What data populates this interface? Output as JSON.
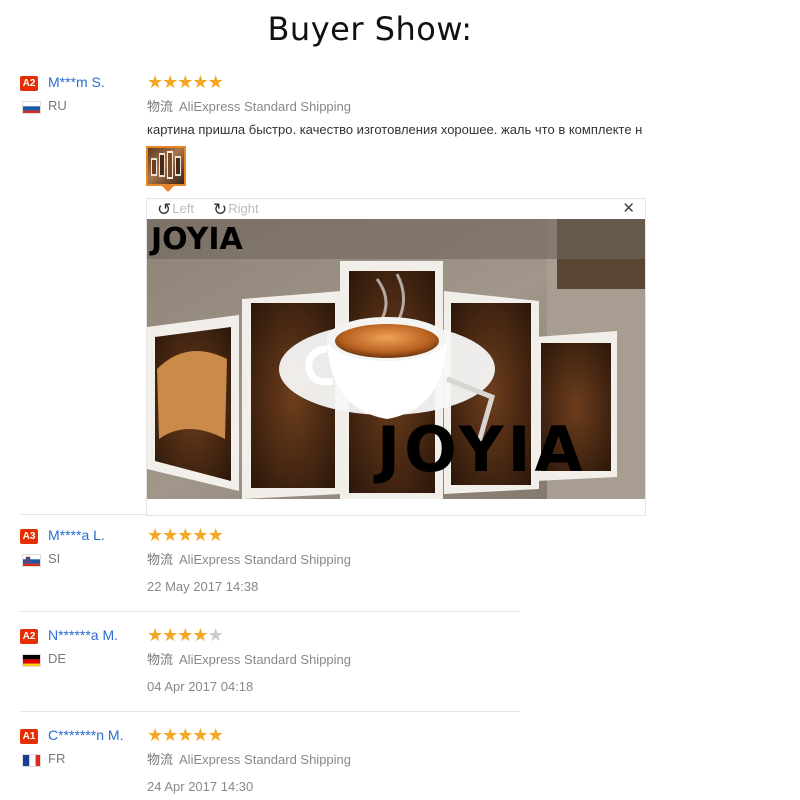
{
  "page": {
    "title": "Buyer Show:"
  },
  "reviews": [
    {
      "badge": "A2",
      "user": "M***m S.",
      "country": "RU",
      "flag": "ru",
      "rating": 5,
      "shipping_prefix": "物流",
      "shipping": "AliExpress Standard Shipping",
      "comment": "картина пришла быстро. качество изготовления хорошее. жаль что в комплекте н",
      "has_photo": true
    },
    {
      "badge": "A3",
      "user": "M****a L.",
      "country": "SI",
      "flag": "si",
      "rating": 5,
      "shipping_prefix": "物流",
      "shipping": "AliExpress Standard Shipping",
      "date": "22 May 2017 14:38"
    },
    {
      "badge": "A2",
      "user": "N******a M.",
      "country": "DE",
      "flag": "de",
      "rating": 4,
      "shipping_prefix": "物流",
      "shipping": "AliExpress Standard Shipping",
      "date": "04 Apr 2017 04:18"
    },
    {
      "badge": "A1",
      "user": "C*******n M.",
      "country": "FR",
      "flag": "fr",
      "rating": 5,
      "shipping_prefix": "物流",
      "shipping": "AliExpress Standard Shipping",
      "date": "24 Apr 2017 14:30"
    }
  ],
  "viewer": {
    "rotate_left": "Left",
    "rotate_right": "Right",
    "close_icon": "close-icon",
    "watermark_small": "JOYIA",
    "watermark_large": "JOYIA"
  },
  "colors": {
    "badge": "#e62e04",
    "username": "#2a6ccf",
    "star": "#f5a623",
    "thumb_border": "#e8862a"
  }
}
